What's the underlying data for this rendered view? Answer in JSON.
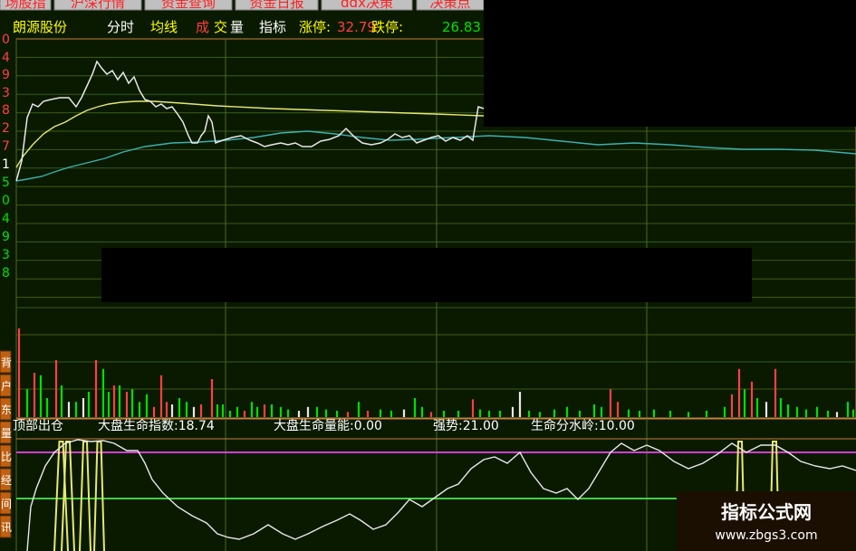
{
  "tabs": [
    "场股指",
    "沪深行情",
    "资金查询",
    "资金日报",
    "ddx决策",
    "决策点"
  ],
  "header": {
    "stock_name": "朗源股份",
    "items": [
      {
        "text": "分时",
        "color": "#ffffff"
      },
      {
        "text": "均线",
        "color": "#ffff00"
      },
      {
        "text": "成",
        "color": "#ff4040"
      },
      {
        "text": "交",
        "color": "#ffff00"
      },
      {
        "text": "量",
        "color": "#ffffff"
      },
      {
        "text": "指标",
        "color": "#ffffff"
      }
    ],
    "limit_up_label": "涨停:",
    "limit_up_value": "32.79",
    "limit_down_label": "跌停:",
    "limit_down_value": "26.83"
  },
  "left_axis_ticks": [
    {
      "text": "0",
      "color": "#ff4040"
    },
    {
      "text": "4",
      "color": "#ff4040"
    },
    {
      "text": "9",
      "color": "#ff4040"
    },
    {
      "text": "3",
      "color": "#ff4040"
    },
    {
      "text": "8",
      "color": "#ff4040"
    },
    {
      "text": "2",
      "color": "#ff4040"
    },
    {
      "text": "7",
      "color": "#ff4040"
    },
    {
      "text": "1",
      "color": "#ffffff"
    },
    {
      "text": "5",
      "color": "#00e000"
    },
    {
      "text": "0",
      "color": "#00e000"
    },
    {
      "text": "4",
      "color": "#00e000"
    },
    {
      "text": "9",
      "color": "#00e000"
    },
    {
      "text": "3",
      "color": "#00e000"
    },
    {
      "text": "8",
      "color": "#00e000"
    }
  ],
  "side_buttons": [
    "背",
    "户",
    "东",
    "量",
    "比",
    "经",
    "间",
    "讯"
  ],
  "indicator": {
    "name": "顶部出仓",
    "items": [
      {
        "label": "大盘生命指数:",
        "value": "18.74"
      },
      {
        "label": "大盘生命量能:",
        "value": "0.00"
      },
      {
        "label": "强势:",
        "value": "21.00"
      },
      {
        "label": "生命分水岭:",
        "value": "10.00"
      }
    ]
  },
  "watermark": {
    "title": "指标公式网",
    "url": "www.zbgs3.com"
  },
  "colors": {
    "grid": "#3a5a1a",
    "axis": "#c08040",
    "price_line": "#e8e8e8",
    "avg_line": "#e8e870",
    "ma_line": "#3cb0b0",
    "vol_up": "#ff4040",
    "vol_down": "#00e000",
    "vol_flat": "#e8e8e8",
    "magenta": "#d040d0",
    "green_level": "#40d040",
    "yellow_spike": "#e8e870",
    "tab_bg": "#c0c0c0",
    "tab_text": "#ff2020"
  }
}
